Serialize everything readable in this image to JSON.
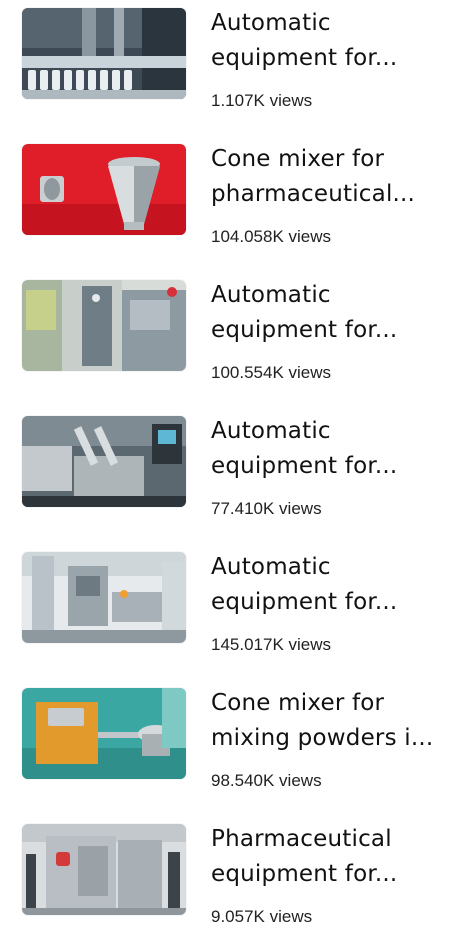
{
  "videos": [
    {
      "title_line1": "Automatic",
      "title_line2": "equipment for...",
      "views": "1.107K views",
      "thumb_theme": "conveyor-bottles",
      "thumb_colors": [
        "#3d4a55",
        "#c9d3da",
        "#8a96a0"
      ]
    },
    {
      "title_line1": "Cone mixer for",
      "title_line2": "pharmaceutical...",
      "views": "104.058K views",
      "thumb_theme": "steel-cone-on-red",
      "thumb_colors": [
        "#e01e2a",
        "#d8dde0",
        "#9aa3a8"
      ]
    },
    {
      "title_line1": "Automatic",
      "title_line2": "equipment for...",
      "views": "100.554K views",
      "thumb_theme": "packaging-machine",
      "thumb_colors": [
        "#a8b6a0",
        "#d7dcd8",
        "#6f7d86"
      ]
    },
    {
      "title_line1": "Automatic",
      "title_line2": "equipment for...",
      "views": "77.410K views",
      "thumb_theme": "steel-hopper-line",
      "thumb_colors": [
        "#5b6870",
        "#c3c9cc",
        "#2d343a"
      ]
    },
    {
      "title_line1": "Automatic",
      "title_line2": "equipment for...",
      "views": "145.017K views",
      "thumb_theme": "factory-machine",
      "thumb_colors": [
        "#b9c2c8",
        "#e6eaec",
        "#6e7a82"
      ]
    },
    {
      "title_line1": "Cone mixer for",
      "title_line2": "mixing powders i...",
      "views": "98.540K views",
      "thumb_theme": "orange-mixer",
      "thumb_colors": [
        "#e39a2c",
        "#3aa7a3",
        "#c0c6c9"
      ]
    },
    {
      "title_line1": "Pharmaceutical",
      "title_line2": "equipment for...",
      "views": "9.057K views",
      "thumb_theme": "tablet-press",
      "thumb_colors": [
        "#b8bec3",
        "#d9dde0",
        "#3c444a"
      ]
    }
  ]
}
